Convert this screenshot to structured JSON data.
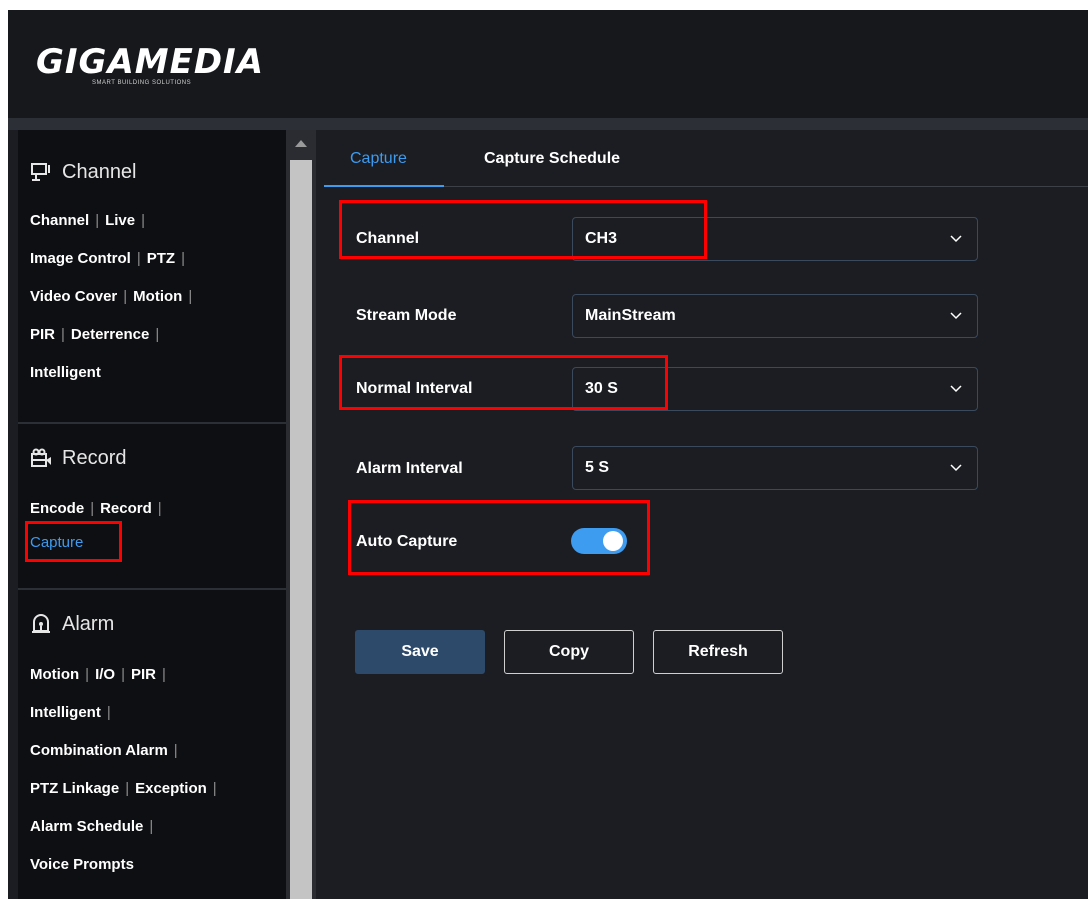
{
  "header": {
    "logo_text": "GIGAMEDIA",
    "logo_tagline": "SMART BUILDING SOLUTIONS"
  },
  "sidebar": {
    "channel": {
      "title": "Channel",
      "icon": "monitor-icon",
      "links": [
        [
          "Channel",
          "Live"
        ],
        [
          "Image Control",
          "PTZ"
        ],
        [
          "Video Cover",
          "Motion"
        ],
        [
          "PIR",
          "Deterrence"
        ],
        [
          "Intelligent"
        ]
      ]
    },
    "record": {
      "title": "Record",
      "icon": "record-icon",
      "links": [
        [
          "Encode",
          "Record"
        ],
        [
          "Capture"
        ]
      ],
      "active": "Capture"
    },
    "alarm": {
      "title": "Alarm",
      "icon": "alarm-icon",
      "links": [
        [
          "Motion",
          "I/O",
          "PIR"
        ],
        [
          "Intelligent"
        ],
        [
          "Combination Alarm"
        ],
        [
          "PTZ Linkage",
          "Exception"
        ],
        [
          "Alarm Schedule"
        ],
        [
          "Voice Prompts"
        ]
      ]
    }
  },
  "tabs": {
    "capture": "Capture",
    "schedule": "Capture Schedule"
  },
  "form": {
    "channel": {
      "label": "Channel",
      "value": "CH3"
    },
    "stream_mode": {
      "label": "Stream Mode",
      "value": "MainStream"
    },
    "normal_interval": {
      "label": "Normal Interval",
      "value": "30 S"
    },
    "alarm_interval": {
      "label": "Alarm Interval",
      "value": "5 S"
    },
    "auto_capture": {
      "label": "Auto Capture",
      "enabled": true
    }
  },
  "buttons": {
    "save": "Save",
    "copy": "Copy",
    "refresh": "Refresh"
  },
  "colors": {
    "accent": "#3d9bf0",
    "highlight": "#ff0000",
    "save_button": "#2e4a6a"
  }
}
